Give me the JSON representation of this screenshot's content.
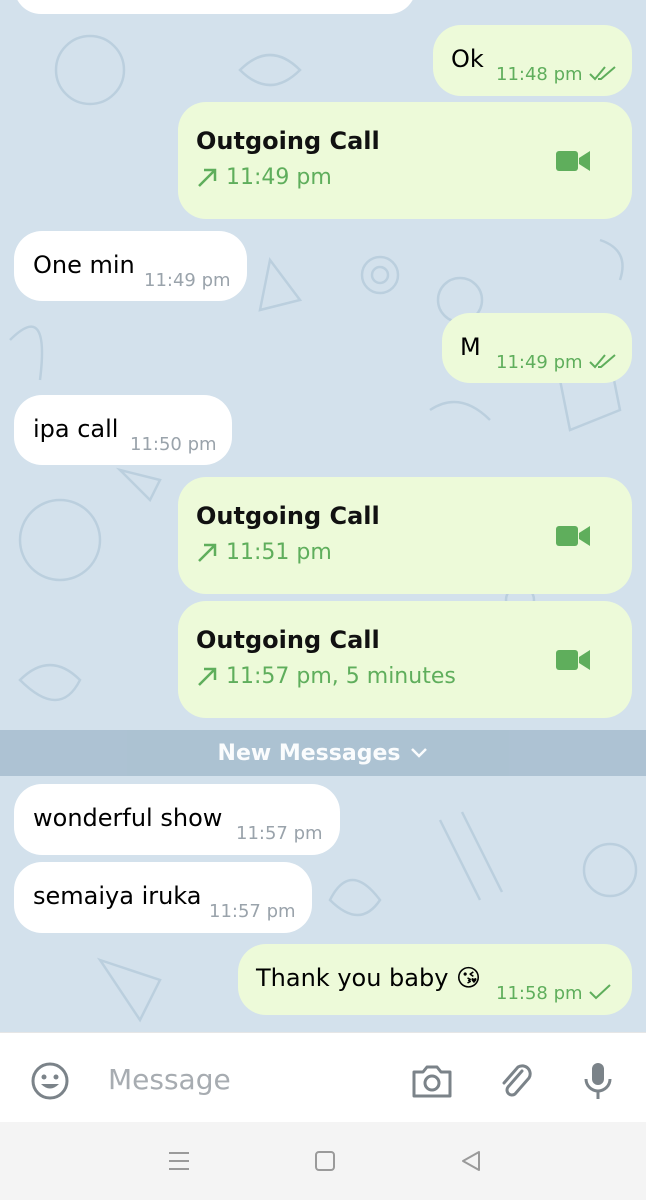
{
  "messages": {
    "m1": {
      "text": "Ok",
      "time": "11:48 pm"
    },
    "call1": {
      "title": "Outgoing Call",
      "detail": "11:49 pm"
    },
    "m2": {
      "text": "One min",
      "time": "11:49 pm"
    },
    "m3": {
      "text": "M",
      "time": "11:49 pm"
    },
    "m4": {
      "text": "ipa call",
      "time": "11:50 pm"
    },
    "call2": {
      "title": "Outgoing Call",
      "detail": "11:51 pm"
    },
    "call3": {
      "title": "Outgoing Call",
      "detail": "11:57 pm, 5 minutes"
    },
    "m5": {
      "text": "wonderful show",
      "time": "11:57 pm"
    },
    "m6": {
      "text": "semaiya iruka",
      "time": "11:57 pm"
    },
    "m7": {
      "text": "Thank you baby 😘",
      "time": "11:58 pm"
    }
  },
  "new_messages_label": "New Messages",
  "composer": {
    "placeholder": "Message"
  },
  "icons": {
    "emoji": "smiley-icon",
    "camera": "camera-icon",
    "attach": "paperclip-icon",
    "mic": "microphone-icon",
    "call": "video-camera-icon",
    "read": "double-check-icon",
    "sent": "single-check-icon"
  },
  "colors": {
    "chat_background": "#d3e1ec",
    "incoming_bubble": "#ffffff",
    "outgoing_bubble": "#edfad9",
    "accent_green": "#5fae5c",
    "new_messages_bar": "#a8bfd0"
  }
}
